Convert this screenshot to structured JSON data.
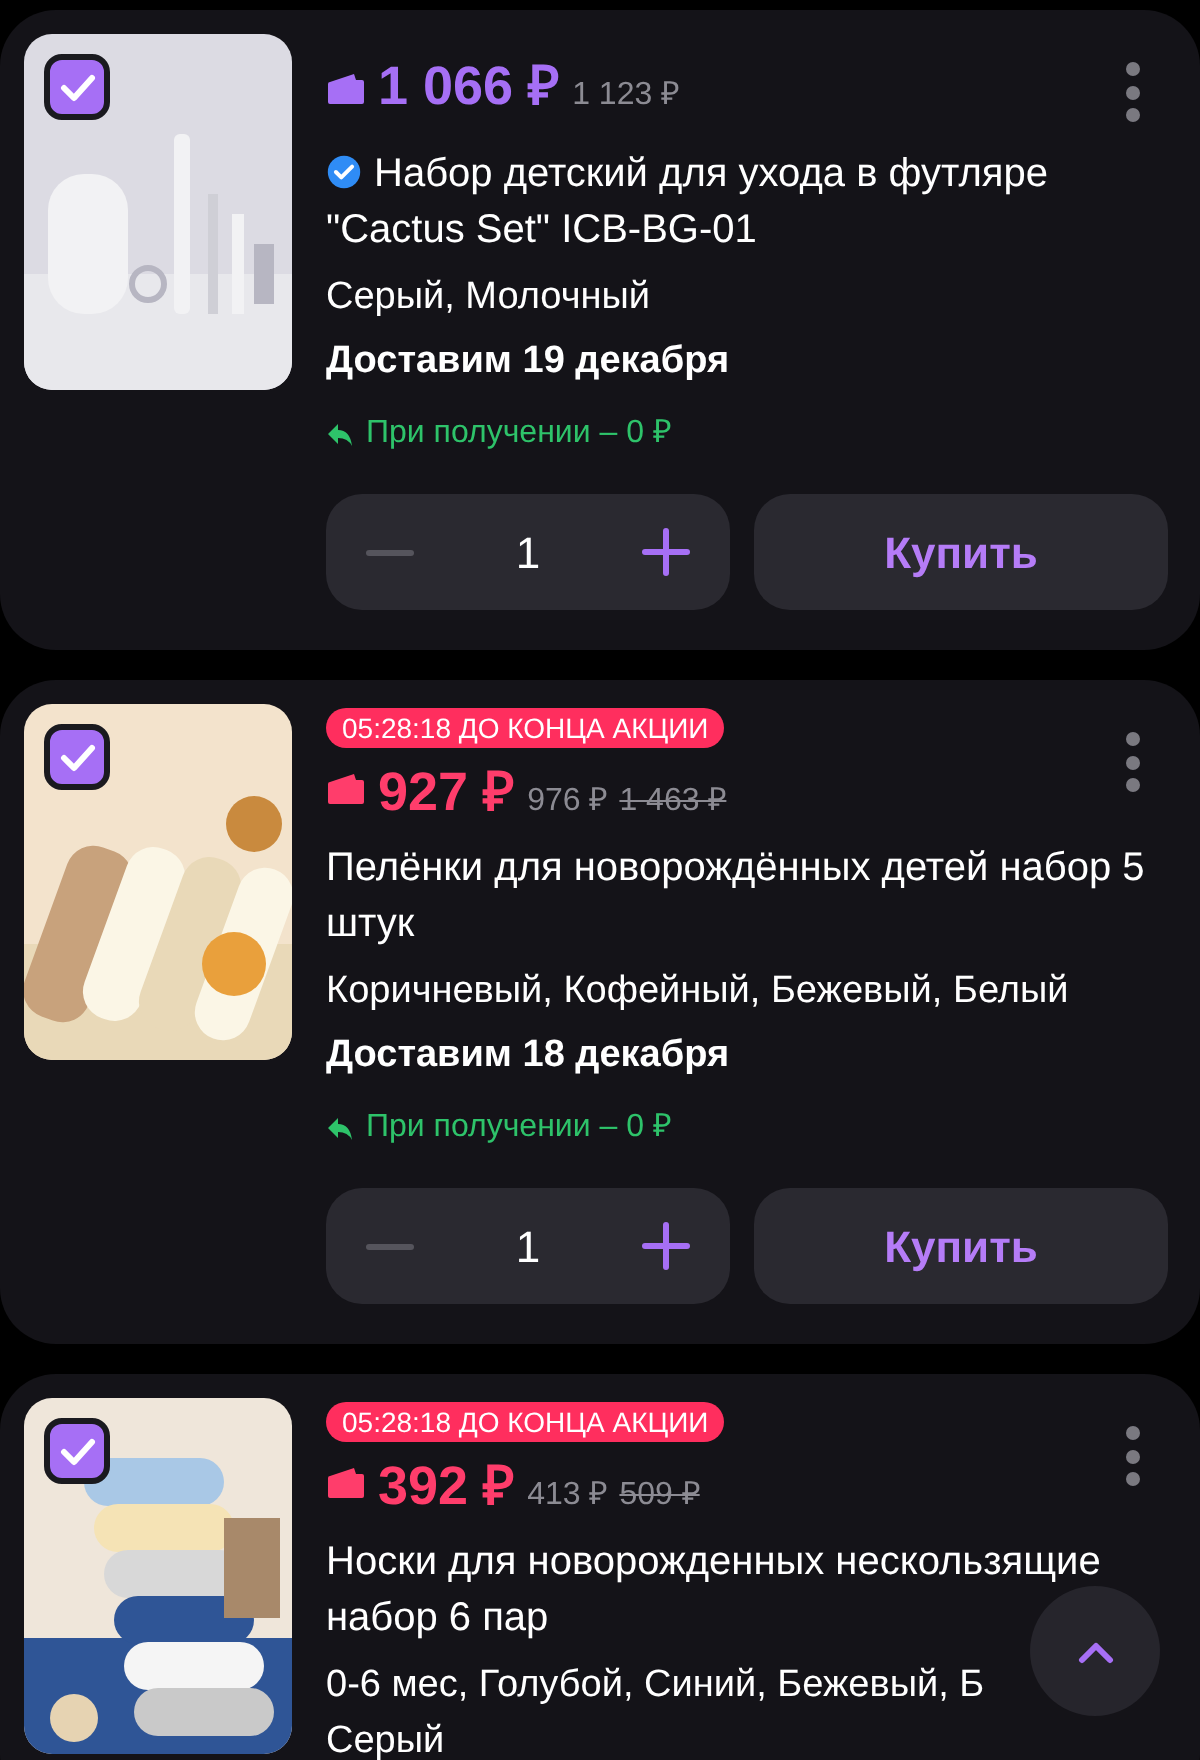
{
  "products": [
    {
      "checked": true,
      "promo": false,
      "price": "1 066 ₽",
      "old_prices": [
        {
          "text": "1 123 ₽",
          "struck": false
        }
      ],
      "verified": true,
      "title": "Набор детский для ухода в футляре \"Cactus Set\" ICB-BG-01",
      "colors": [
        "Серый, Молочный"
      ],
      "delivery": "Доставим 19 декабря",
      "returns": "При получении – 0 ₽",
      "quantity": "1",
      "decrease_disabled": true,
      "buy_label": "Купить"
    },
    {
      "checked": true,
      "timer": "05:28:18 ДО КОНЦА АКЦИИ",
      "promo": true,
      "price": "927 ₽",
      "old_prices": [
        {
          "text": "976 ₽",
          "struck": false
        },
        {
          "text": "1 463 ₽",
          "struck": true
        }
      ],
      "verified": false,
      "title": "Пелёнки для новорождённых детей набор 5 штук",
      "colors": [
        "Коричневый, Кофейный, Бежевый, Белый"
      ],
      "delivery": "Доставим 18 декабря",
      "returns": "При получении – 0 ₽",
      "quantity": "1",
      "decrease_disabled": true,
      "buy_label": "Купить"
    },
    {
      "checked": true,
      "timer": "05:28:18 ДО КОНЦА АКЦИИ",
      "promo": true,
      "price": "392 ₽",
      "old_prices": [
        {
          "text": "413 ₽",
          "struck": false
        },
        {
          "text": "509 ₽",
          "struck": true
        }
      ],
      "verified": false,
      "title": "Носки для новорожденных нескользящие набор 6 пар",
      "colors": [
        "0-6 мес, Голубой, Синий, Бежевый, Б",
        "Серый"
      ]
    }
  ]
}
